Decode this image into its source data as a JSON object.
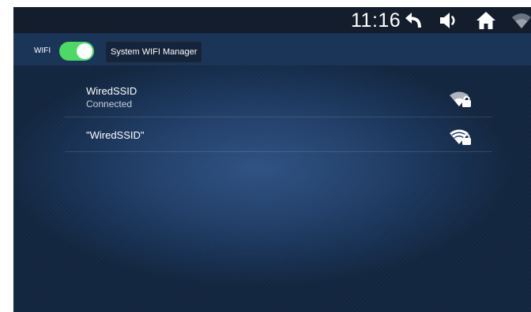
{
  "status_bar": {
    "time": "11:16",
    "icons": [
      "back-arrow-icon",
      "volume-icon",
      "home-icon",
      "wifi-signal-icon"
    ]
  },
  "toolbar": {
    "wifi_label": "WIFI",
    "wifi_enabled": true,
    "manager_button_label": "System WIFI Manager"
  },
  "networks": [
    {
      "ssid": "WiredSSID",
      "status": "Connected",
      "secured": true,
      "icon": "wifi-lock-icon"
    },
    {
      "ssid": "\"WiredSSID\"",
      "status": "",
      "secured": true,
      "icon": "wifi-lock-icon"
    }
  ],
  "colors": {
    "status_bar_bg": "#141d2c",
    "toolbar_bg": "#1b3558",
    "toggle_on": "#4cd964",
    "background": "#22406a"
  }
}
